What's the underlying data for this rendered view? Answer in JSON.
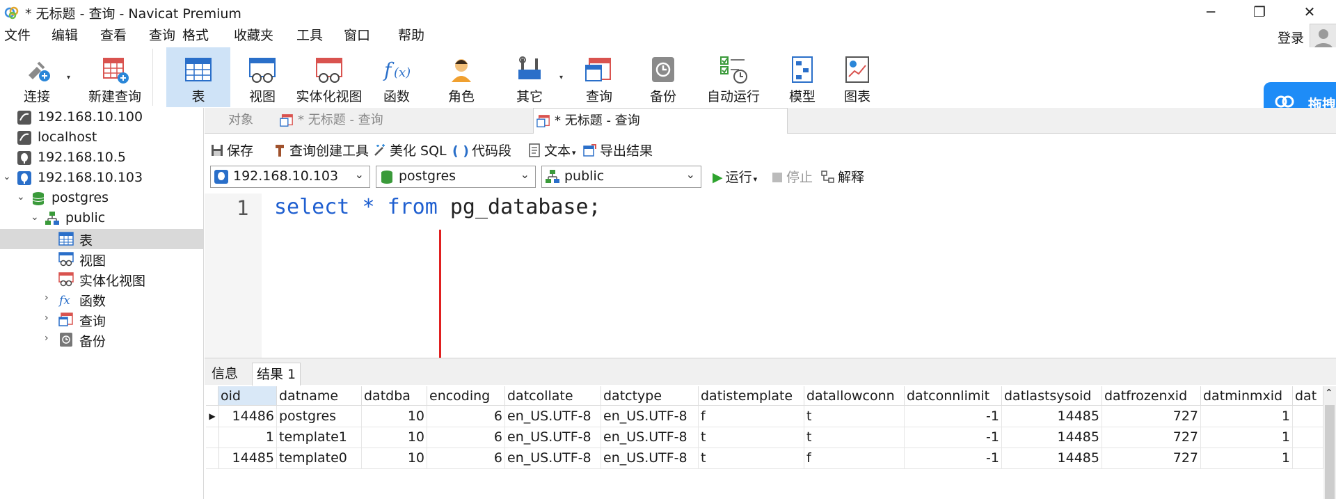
{
  "window": {
    "title": "* 无标题 - 查询 - Navicat Premium",
    "minimize_glyph": "─",
    "restore_glyph": "❐",
    "close_glyph": "✕"
  },
  "menu": [
    "文件",
    "编辑",
    "查看",
    "查询",
    "格式",
    "收藏夹",
    "工具",
    "窗口",
    "帮助"
  ],
  "login_label": "登录",
  "toolbar": {
    "items": [
      {
        "label": "连接",
        "icon": "connect-icon"
      },
      {
        "label": "新建查询",
        "icon": "new-query-icon"
      },
      {
        "label": "表",
        "icon": "table-icon",
        "active": true
      },
      {
        "label": "视图",
        "icon": "view-icon"
      },
      {
        "label": "实体化视图",
        "icon": "materialized-view-icon"
      },
      {
        "label": "函数",
        "icon": "function-icon"
      },
      {
        "label": "角色",
        "icon": "role-icon"
      },
      {
        "label": "其它",
        "icon": "tools-icon"
      },
      {
        "label": "查询",
        "icon": "query-icon"
      },
      {
        "label": "备份",
        "icon": "backup-icon"
      },
      {
        "label": "自动运行",
        "icon": "auto-run-icon"
      },
      {
        "label": "模型",
        "icon": "model-icon"
      },
      {
        "label": "图表",
        "icon": "chart-icon"
      }
    ]
  },
  "baidu_label": "拖拽",
  "tree": {
    "nodes": [
      {
        "label": "192.168.10.100",
        "icon": "mysql-server-icon"
      },
      {
        "label": "localhost",
        "icon": "mysql-server-icon"
      },
      {
        "label": "192.168.10.5",
        "icon": "postgres-server-icon"
      },
      {
        "label": "192.168.10.103",
        "icon": "postgres-server-icon",
        "expanded": true
      },
      {
        "label": "postgres",
        "icon": "database-icon",
        "expanded": true
      },
      {
        "label": "public",
        "icon": "schema-icon",
        "expanded": true
      },
      {
        "label": "表",
        "icon": "table-icon",
        "selected": true
      },
      {
        "label": "视图",
        "icon": "view-icon"
      },
      {
        "label": "实体化视图",
        "icon": "materialized-view-icon"
      },
      {
        "label": "函数",
        "icon": "function-icon"
      },
      {
        "label": "查询",
        "icon": "query-icon"
      },
      {
        "label": "备份",
        "icon": "backup-icon"
      }
    ]
  },
  "tabs": [
    {
      "label": "对象"
    },
    {
      "label": "* 无标题 - 查询"
    },
    {
      "label": "* 无标题 - 查询",
      "active": true
    }
  ],
  "query_toolbar": {
    "save": "保存",
    "builder": "查询创建工具",
    "beautify": "美化 SQL",
    "snippet": "代码段",
    "text": "文本",
    "export": "导出结果"
  },
  "selectors": {
    "connection": "192.168.10.103",
    "database": "postgres",
    "schema": "public",
    "run": "运行",
    "stop": "停止",
    "explain": "解释"
  },
  "editor": {
    "line_number": "1",
    "code": {
      "kw1": "select",
      "star": "*",
      "kw2": "from",
      "ident": "pg_database;"
    }
  },
  "result_tabs": [
    {
      "label": "信息"
    },
    {
      "label": "结果 1",
      "active": true
    }
  ],
  "grid": {
    "columns": [
      "oid",
      "datname",
      "datdba",
      "encoding",
      "datcollate",
      "datctype",
      "datistemplate",
      "datallowconn",
      "datconnlimit",
      "datlastsysoid",
      "datfrozenxid",
      "datminmxid",
      "dat"
    ],
    "rows": [
      [
        "14486",
        "postgres",
        "10",
        "6",
        "en_US.UTF-8",
        "en_US.UTF-8",
        "f",
        "t",
        "-1",
        "14485",
        "727",
        "1",
        ""
      ],
      [
        "1",
        "template1",
        "10",
        "6",
        "en_US.UTF-8",
        "en_US.UTF-8",
        "t",
        "t",
        "-1",
        "14485",
        "727",
        "1",
        ""
      ],
      [
        "14485",
        "template0",
        "10",
        "6",
        "en_US.UTF-8",
        "en_US.UTF-8",
        "t",
        "f",
        "-1",
        "14485",
        "727",
        "1",
        ""
      ]
    ],
    "numeric_columns": [
      0,
      2,
      3,
      8,
      9,
      10,
      11
    ]
  },
  "colors": {
    "accent_blue": "#1f5fd0",
    "active_toolbar": "#cfe3f7",
    "arrow_red": "#e02020",
    "baidu_blue": "#1e8cf7"
  }
}
